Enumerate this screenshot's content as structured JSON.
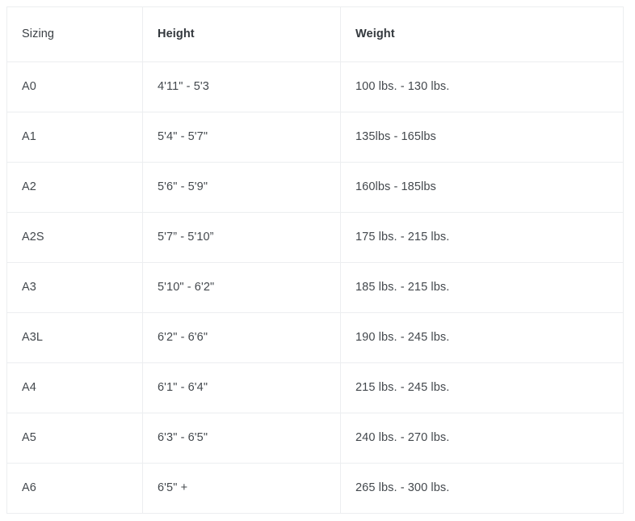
{
  "table": {
    "columns": [
      {
        "label": "Sizing",
        "bold": false
      },
      {
        "label": "Height",
        "bold": true
      },
      {
        "label": "Weight",
        "bold": true
      }
    ],
    "rows": [
      {
        "sizing": "A0",
        "height": "4'11\" - 5'3",
        "weight": "100 lbs. - 130 lbs."
      },
      {
        "sizing": "A1",
        "height": "5'4\" - 5'7\"",
        "weight": "135lbs - 165lbs"
      },
      {
        "sizing": "A2",
        "height": "5'6\" - 5'9\"",
        "weight": "160lbs - 185lbs"
      },
      {
        "sizing": "A2S",
        "height": "5'7” - 5'10”",
        "weight": "175 lbs. - 215 lbs."
      },
      {
        "sizing": "A3",
        "height": "5'10\" - 6'2\"",
        "weight": "185 lbs. - 215 lbs."
      },
      {
        "sizing": "A3L",
        "height": "6'2\" - 6'6\"",
        "weight": "190 lbs. - 245 lbs."
      },
      {
        "sizing": "A4",
        "height": "6'1\" - 6'4\"",
        "weight": "215 lbs. - 245 lbs."
      },
      {
        "sizing": "A5",
        "height": "6'3\" - 6'5\"",
        "weight": "240 lbs. - 270 lbs."
      },
      {
        "sizing": "A6",
        "height": "6'5\" +",
        "weight": "265 lbs. - 300 lbs."
      }
    ]
  },
  "colors": {
    "background": "#ffffff",
    "border": "#eceef0",
    "text": "#43484d",
    "header_text": "#33383d"
  }
}
